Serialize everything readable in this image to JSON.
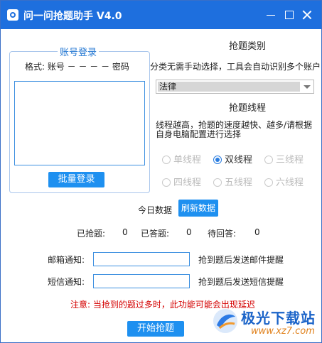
{
  "window": {
    "title": "问一问抢题助手 V4.0"
  },
  "account_group": {
    "title": "账号登录",
    "format": "格式: 账号 － － － － 密码",
    "batch_login_label": "批量登录"
  },
  "category": {
    "heading": "抢题类别",
    "hint": "分类无需手动选择，工具会自动识别多个账户",
    "selected": "法律"
  },
  "threads": {
    "heading": "抢题线程",
    "hint_line1": "线程越高，抢题的速度越快、越多/请根据",
    "hint_line2": "自身电脑配置进行选择",
    "options": [
      "单线程",
      "双线程",
      "三线程",
      "四线程",
      "五线程",
      "六线程"
    ],
    "selected_index": 1
  },
  "stats": {
    "today_label": "今日数据",
    "refresh_label": "刷新数据",
    "grabbed_label": "已抢题:",
    "grabbed_value": "0",
    "answered_label": "已答题:",
    "answered_value": "0",
    "pending_label": "待回答:",
    "pending_value": "0"
  },
  "notify": {
    "email_label": "邮箱通知:",
    "email_desc": "抢到题后发送邮件提醒",
    "sms_label": "短信通知:",
    "sms_desc": "抢到题后发送短信提醒"
  },
  "warning": "注意: 当抢到的题过多时，此功能可能会出现延迟",
  "start_label": "开始抢题",
  "watermark": {
    "name": "极光下载站",
    "url": "www.xz7.com"
  },
  "colors": {
    "title_bar": "#1e6fde",
    "button": "#1e90f0",
    "accent": "#2176d2",
    "warning": "#d40000"
  }
}
